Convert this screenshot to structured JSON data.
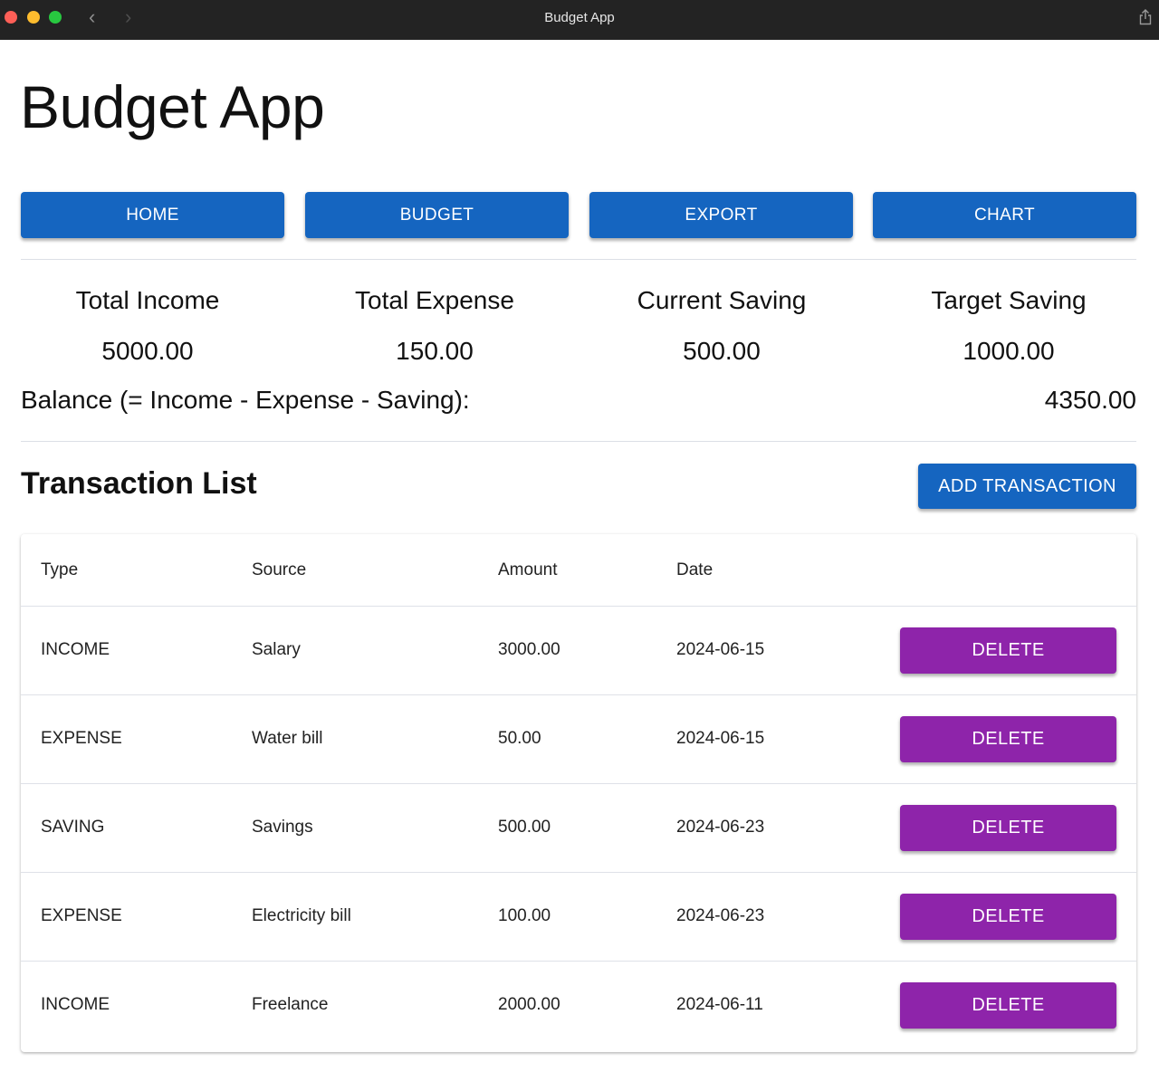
{
  "window": {
    "title": "Budget App",
    "back_icon": "chevron-left-icon",
    "forward_icon": "chevron-right-icon",
    "share_icon": "share-icon"
  },
  "app": {
    "title": "Budget App"
  },
  "nav": {
    "buttons": [
      {
        "label": "HOME"
      },
      {
        "label": "BUDGET"
      },
      {
        "label": "EXPORT"
      },
      {
        "label": "CHART"
      }
    ]
  },
  "summary": {
    "items": [
      {
        "label": "Total Income",
        "value": "5000.00"
      },
      {
        "label": "Total Expense",
        "value": "150.00"
      },
      {
        "label": "Current Saving",
        "value": "500.00"
      },
      {
        "label": "Target Saving",
        "value": "1000.00"
      }
    ],
    "balance_label": "Balance (= Income - Expense - Saving):",
    "balance_value": "4350.00"
  },
  "transactions": {
    "title": "Transaction List",
    "add_label": "ADD TRANSACTION",
    "columns": [
      "Type",
      "Source",
      "Amount",
      "Date"
    ],
    "delete_label": "DELETE",
    "rows": [
      {
        "type": "INCOME",
        "source": "Salary",
        "amount": "3000.00",
        "date": "2024-06-15"
      },
      {
        "type": "EXPENSE",
        "source": "Water bill",
        "amount": "50.00",
        "date": "2024-06-15"
      },
      {
        "type": "SAVING",
        "source": "Savings",
        "amount": "500.00",
        "date": "2024-06-23"
      },
      {
        "type": "EXPENSE",
        "source": "Electricity bill",
        "amount": "100.00",
        "date": "2024-06-23"
      },
      {
        "type": "INCOME",
        "source": "Freelance",
        "amount": "2000.00",
        "date": "2024-06-11"
      }
    ]
  },
  "colors": {
    "primary": "#1565c0",
    "delete": "#8e24aa",
    "titlebar": "#232323"
  }
}
